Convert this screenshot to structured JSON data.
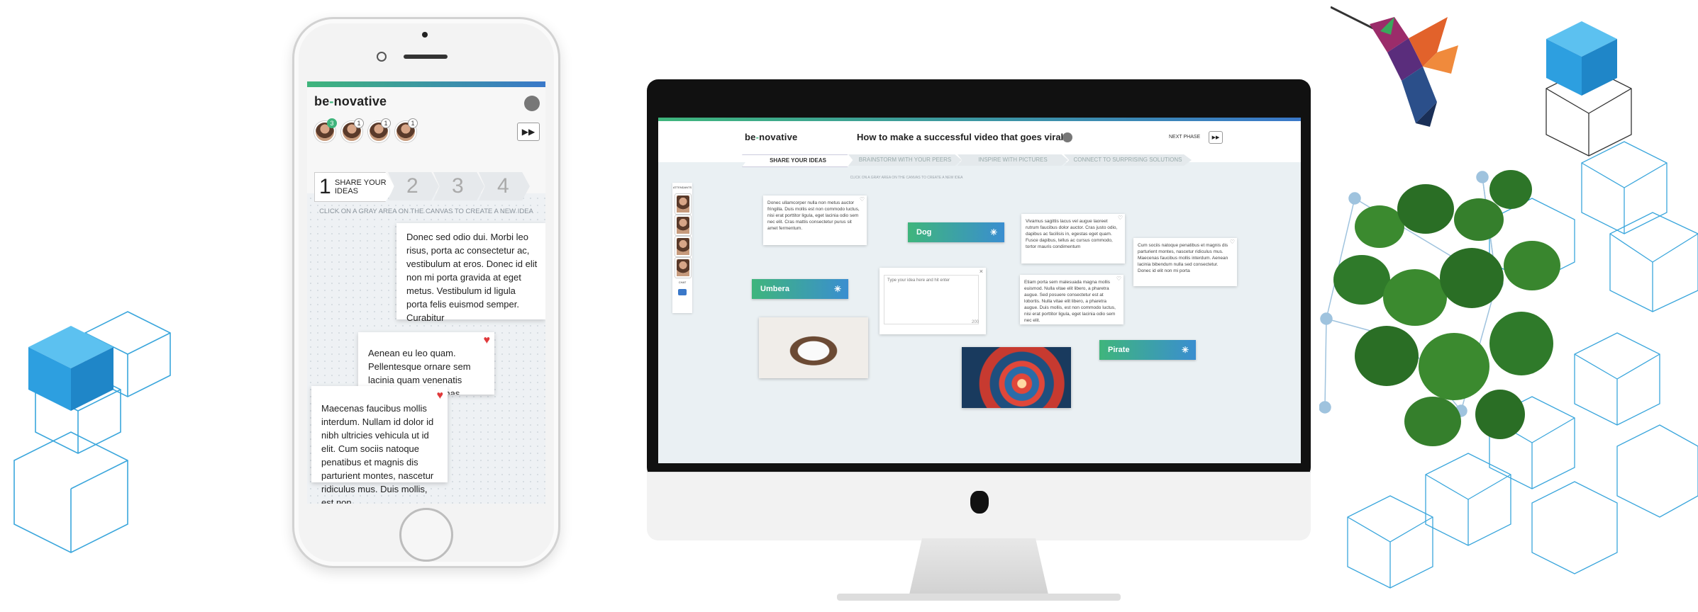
{
  "phone_app": {
    "logo": {
      "prefix": "be",
      "dash": "-",
      "suffix": "novative"
    },
    "attendee_badges": [
      "3",
      "1",
      "1",
      "1"
    ],
    "steps": [
      {
        "number": "1",
        "label_line1": "SHARE YOUR",
        "label_line2": "IDEAS"
      },
      {
        "number": "2"
      },
      {
        "number": "3"
      },
      {
        "number": "4"
      }
    ],
    "instruction": "CLICK ON A GRAY AREA ON THE CANVAS TO CREATE A NEW IDEA",
    "cards": [
      {
        "text": "Donec sed odio dui. Morbi leo risus, porta ac consectetur ac, vestibulum at eros. Donec id elit non mi porta gravida at eget metus. Vestibulum id ligula porta felis euismod semper. Curabitur"
      },
      {
        "text": "Aenean eu leo quam. Pellentesque ornare sem lacinia quam venenatis vestibulum. Maecenas faucibus mollis interdum. Sed"
      },
      {
        "text": "Maecenas faucibus mollis interdum. Nullam id dolor id nibh ultricies vehicula ut id elit. Cum sociis natoque penatibus et magnis dis parturient montes, nascetur ridiculus mus. Duis mollis, est non"
      }
    ]
  },
  "desktop_app": {
    "logo": {
      "prefix": "be",
      "dash": "-",
      "suffix": "novative"
    },
    "question": "How to make a successful video that goes viral?",
    "next_phase": "NEXT PHASE",
    "tabs": [
      "SHARE YOUR IDEAS",
      "BRAINSTORM WITH YOUR PEERS",
      "INSPIRE WITH PICTURES",
      "CONNECT TO SURPRISING SOLUTIONS"
    ],
    "instruction": "CLICK ON A GRAY AREA ON THE CANVAS TO CREATE A NEW IDEA",
    "sidebar": {
      "attendants_label": "ATTENDANTS",
      "chat_label": "CHAT"
    },
    "tags": [
      "Dog",
      "Umbera",
      "Pirate"
    ],
    "input_placeholder": "Type your idea here and hit enter",
    "input_counter": "200",
    "cards": [
      {
        "text": "Donec ullamcorper nulla non metus auctor fringilla. Duis mollis est non commodo luctus, nisi erat porttitor ligula, eget lacinia odio sem nec elit. Cras mattis consectetur purus sit amet fermentum."
      },
      {
        "text": "Vivamus sagittis lacus vel augue laoreet rutrum faucibus dolor auctor. Cras justo odio, dapibus ac facilisis in, egestas eget quam. Fusce dapibus, tellus ac cursus commodo, tortor mauris condimentum"
      },
      {
        "text": "Cum sociis natoque penatibus et magnis dis parturient montes, nascetur ridiculus mus. Maecenas faucibus mollis interdum. Aenean lacinia bibendum nulla sed consectetur. Donec id elit non mi porta"
      },
      {
        "text": "Etiam porta sem malesuada magna mollis euismod. Nulla vitae elit libero, a pharetra augue. Sed posuere consectetur est at lobortis. Nulla vitae elit libero, a pharetra augue. Duis mollis, est non commodo luctus, nisi erat porttitor ligula, eget lacinia odio sem nec elit."
      }
    ]
  },
  "colors": {
    "accent_green": "#3fb57c",
    "accent_blue": "#3a8ed0",
    "deco_blue": "#2d9fe0",
    "heart_red": "#e0393b"
  }
}
